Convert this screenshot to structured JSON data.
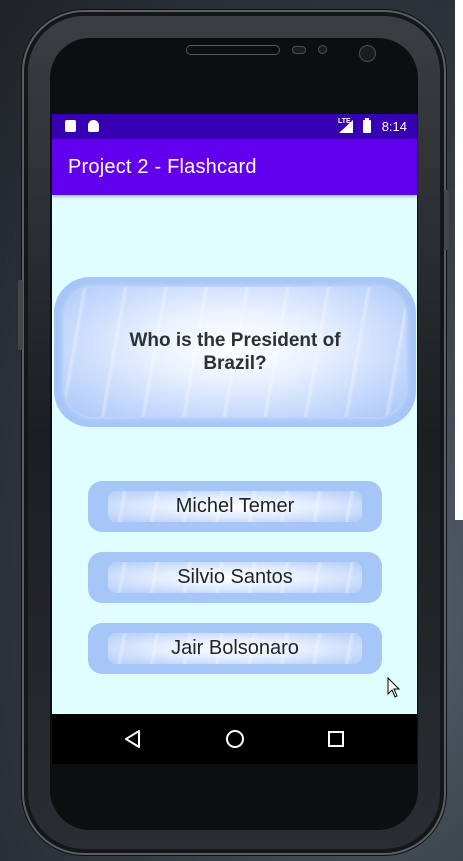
{
  "status_bar": {
    "time": "8:14",
    "network": "LTE",
    "icons": [
      "sd-card-icon",
      "android-icon",
      "signal-icon",
      "battery-icon"
    ]
  },
  "app_bar": {
    "title": "Project 2 - Flashcard"
  },
  "question": {
    "text": "Who is the President of Brazil?"
  },
  "answers": [
    {
      "label": "Michel Temer"
    },
    {
      "label": "Silvio Santos"
    },
    {
      "label": "Jair Bolsonaro"
    }
  ],
  "nav_bar": {
    "icons": [
      "back-icon",
      "home-icon",
      "recents-icon"
    ]
  },
  "colors": {
    "status_bar": "#3700b3",
    "app_bar": "#6200ee",
    "background": "#e0feff",
    "card": "#a7c6f8"
  }
}
